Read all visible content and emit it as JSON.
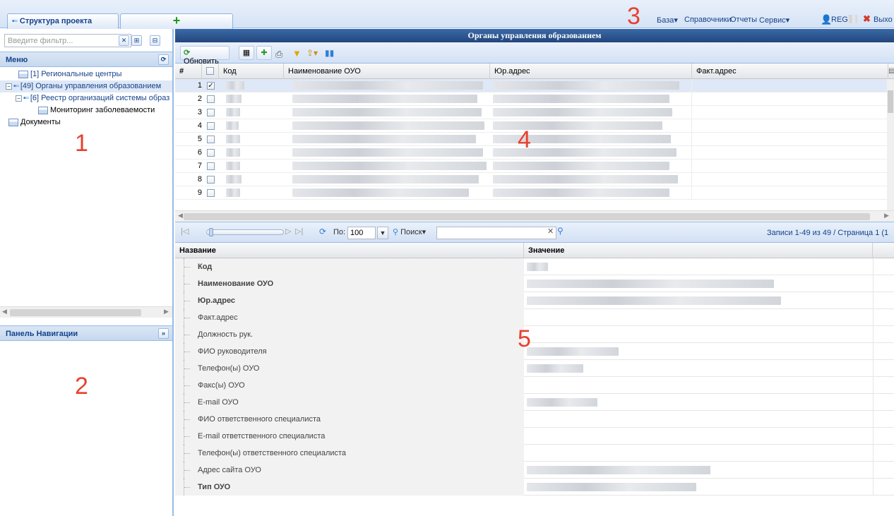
{
  "tabs": {
    "project_structure": "Структура проекта",
    "add": "+"
  },
  "top_menu": {
    "items": [
      "База▾",
      "Справочники",
      "Отчеты",
      "Сервис▾"
    ],
    "user": "REG",
    "exit": "Выхо"
  },
  "left": {
    "filter_placeholder": "Введите фильтр...",
    "menu_title": "Меню",
    "tree": [
      "[1] Региональные центры",
      "[49] Органы управления образованием",
      "[6] Реестр организаций системы образ",
      "Мониторинг заболеваемости",
      "Документы"
    ],
    "nav_title": "Панель Навигации"
  },
  "main": {
    "title": "Органы управления образованием",
    "refresh_label": "Обновить",
    "columns": [
      "#",
      "Код",
      "Наименование ОУО",
      "Юр.адрес",
      "Факт.адрес"
    ],
    "row_numbers": [
      "1",
      "2",
      "3",
      "4",
      "5",
      "6",
      "7",
      "8",
      "9"
    ],
    "checked_symbol": "✓"
  },
  "pager": {
    "per_page_label": "По:",
    "per_page_value": "100",
    "search_label": "Поиск▾",
    "records": "Записи 1-49 из 49 / Страница 1 (1"
  },
  "props": {
    "head_name": "Название",
    "head_value": "Значение",
    "rows": [
      {
        "name": "Код",
        "bold": true
      },
      {
        "name": "Наименование ОУО",
        "bold": true
      },
      {
        "name": "Юр.адрес",
        "bold": true
      },
      {
        "name": "Факт.адрес",
        "bold": false
      },
      {
        "name": "Должность рук.",
        "bold": false
      },
      {
        "name": "ФИО руководителя",
        "bold": false
      },
      {
        "name": "Телефон(ы) ОУО",
        "bold": false
      },
      {
        "name": "Факс(ы) ОУО",
        "bold": false
      },
      {
        "name": "E-mail ОУО",
        "bold": false
      },
      {
        "name": "ФИО ответственного специалиста",
        "bold": false
      },
      {
        "name": "E-mail ответственного специалиста",
        "bold": false
      },
      {
        "name": "Телефон(ы) ответственного специалиста",
        "bold": false
      },
      {
        "name": "Адрес сайта ОУО",
        "bold": false
      },
      {
        "name": "Тип ОУО",
        "bold": true
      }
    ]
  },
  "markers": [
    "1",
    "2",
    "3",
    "4",
    "5"
  ]
}
